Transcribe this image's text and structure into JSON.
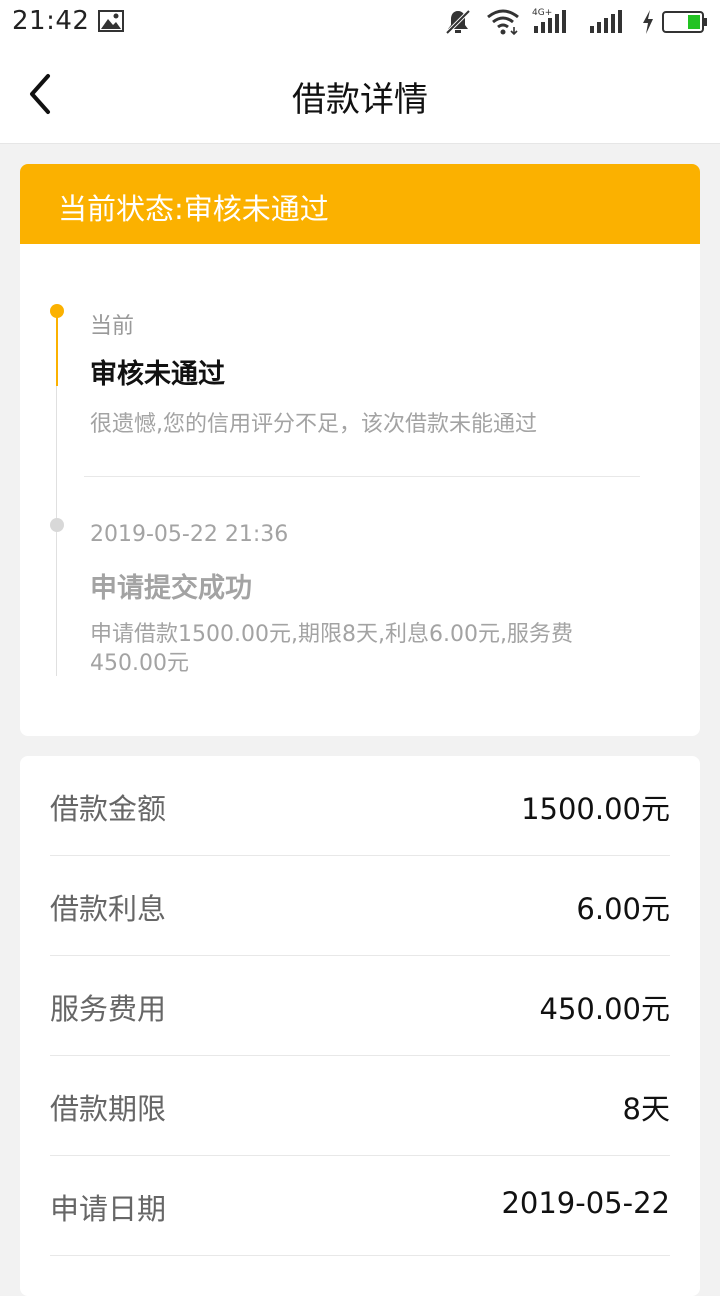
{
  "status_bar": {
    "time": "21:42",
    "network_label": "4G+"
  },
  "nav": {
    "title": "借款详情"
  },
  "status_banner": {
    "text": "当前状态:审核未通过"
  },
  "timeline": [
    {
      "time": "当前",
      "title": "审核未通过",
      "desc": "很遗憾,您的信用评分不足，该次借款未能通过"
    },
    {
      "time": "2019-05-22 21:36",
      "title": "申请提交成功",
      "desc": "申请借款1500.00元,期限8天,利息6.00元,服务费450.00元"
    }
  ],
  "details": [
    {
      "label": "借款金额",
      "value": "1500.00元"
    },
    {
      "label": "借款利息",
      "value": "6.00元"
    },
    {
      "label": "服务费用",
      "value": "450.00元"
    },
    {
      "label": "借款期限",
      "value": "8天"
    },
    {
      "label": "申请日期",
      "value": "2019-05-22"
    }
  ],
  "colors": {
    "accent": "#fbb100",
    "background": "#f2f2f2"
  },
  "icons": {
    "status_bar": [
      "gallery-icon",
      "mute-icon",
      "wifi-icon",
      "signal-icon",
      "charging-icon",
      "battery-icon"
    ],
    "nav": "back-arrow-icon"
  }
}
